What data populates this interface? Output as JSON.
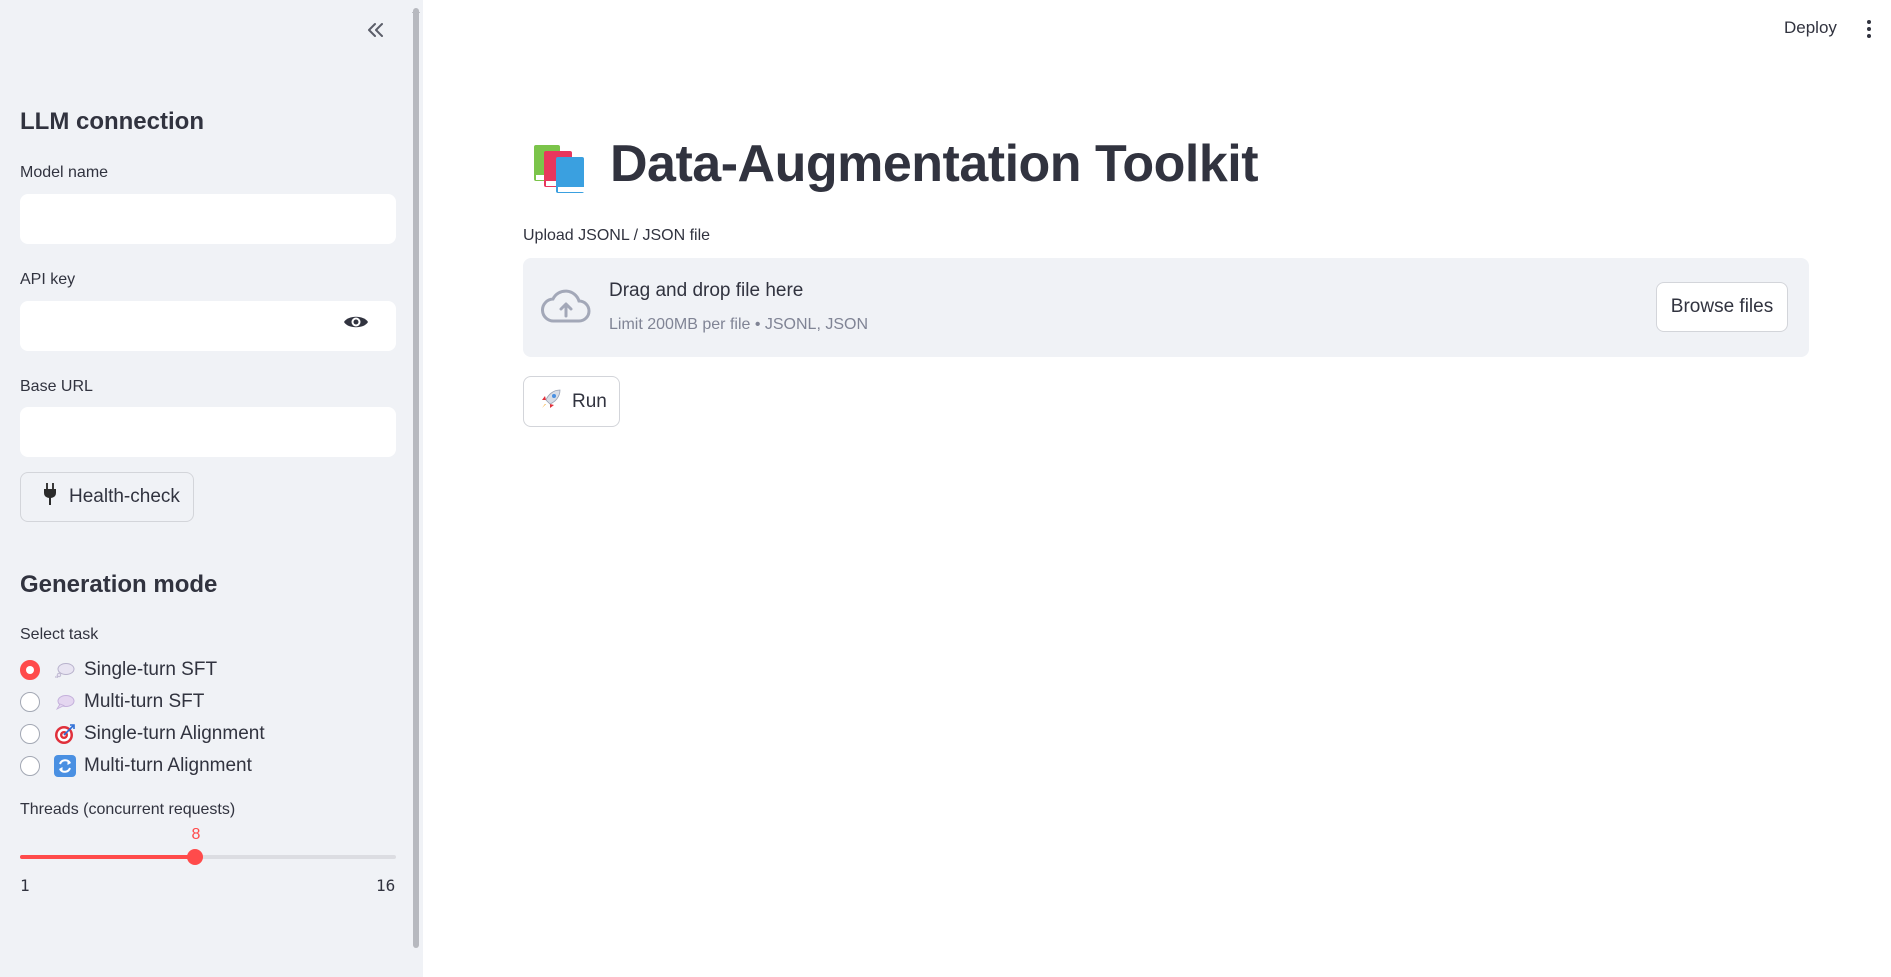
{
  "sidebar": {
    "collapse_icon": "double-chevron-left-icon",
    "llm_heading": "LLM connection",
    "model_name_label": "Model name",
    "model_name_value": "",
    "api_key_label": "API key",
    "api_key_value": "",
    "api_key_toggle_icon": "eye-icon",
    "base_url_label": "Base URL",
    "base_url_value": "",
    "health_check": {
      "icon": "plug-icon",
      "label": "Health-check"
    },
    "generation_heading": "Generation mode",
    "select_task_label": "Select task",
    "tasks": [
      {
        "icon": "thought-bubble-icon",
        "label": "Single-turn SFT",
        "selected": true
      },
      {
        "icon": "speech-bubble-icon",
        "label": "Multi-turn SFT",
        "selected": false
      },
      {
        "icon": "target-icon",
        "label": "Single-turn Alignment",
        "selected": false
      },
      {
        "icon": "cycle-arrows-icon",
        "label": "Multi-turn Alignment",
        "selected": false
      }
    ],
    "threads": {
      "label": "Threads (concurrent requests)",
      "value": 8,
      "min": 1,
      "max": 16,
      "value_text": "8",
      "min_text": "1",
      "max_text": "16"
    }
  },
  "header": {
    "deploy_label": "Deploy",
    "menu_icon": "kebab-menu-icon"
  },
  "main": {
    "title_icon": "books-icon",
    "title": "Data-Augmentation Toolkit",
    "upload_label": "Upload JSONL / JSON file",
    "dropzone": {
      "icon": "cloud-upload-icon",
      "title": "Drag and drop file here",
      "subtitle": "Limit 200MB per file • JSONL, JSON",
      "browse_label": "Browse files"
    },
    "run_button": {
      "icon": "rocket-icon",
      "label": "Run"
    }
  },
  "colors": {
    "accent": "#ff4b4b",
    "sidebar_bg": "#f0f2f6",
    "text": "#31333f",
    "muted_text": "#808495"
  }
}
